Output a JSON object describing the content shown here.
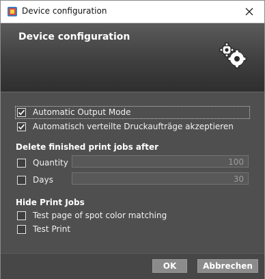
{
  "window": {
    "title": "Device configuration"
  },
  "header": {
    "title": "Device configuration",
    "icon": "gears-icon"
  },
  "options": [
    {
      "label": "Automatic Output Mode",
      "checked": true
    },
    {
      "label": "Automatisch verteilte Druckaufträge akzeptieren",
      "checked": true
    }
  ],
  "delete_section": {
    "title": "Delete finished print jobs after",
    "quantity_label": "Quantity",
    "quantity_value": "100",
    "quantity_checked": false,
    "days_label": "Days",
    "days_value": "30",
    "days_checked": false
  },
  "hide_section": {
    "title": "Hide Print Jobs",
    "items": [
      {
        "label": "Test page of spot color matching",
        "checked": false
      },
      {
        "label": "Test Print",
        "checked": false
      }
    ]
  },
  "footer": {
    "ok_label": "OK",
    "cancel_label": "Abbrechen"
  },
  "colors": {
    "dialog_bg": "#4f4f4f",
    "button_bg": "#8b8b8b",
    "text": "#f2f2f2"
  }
}
